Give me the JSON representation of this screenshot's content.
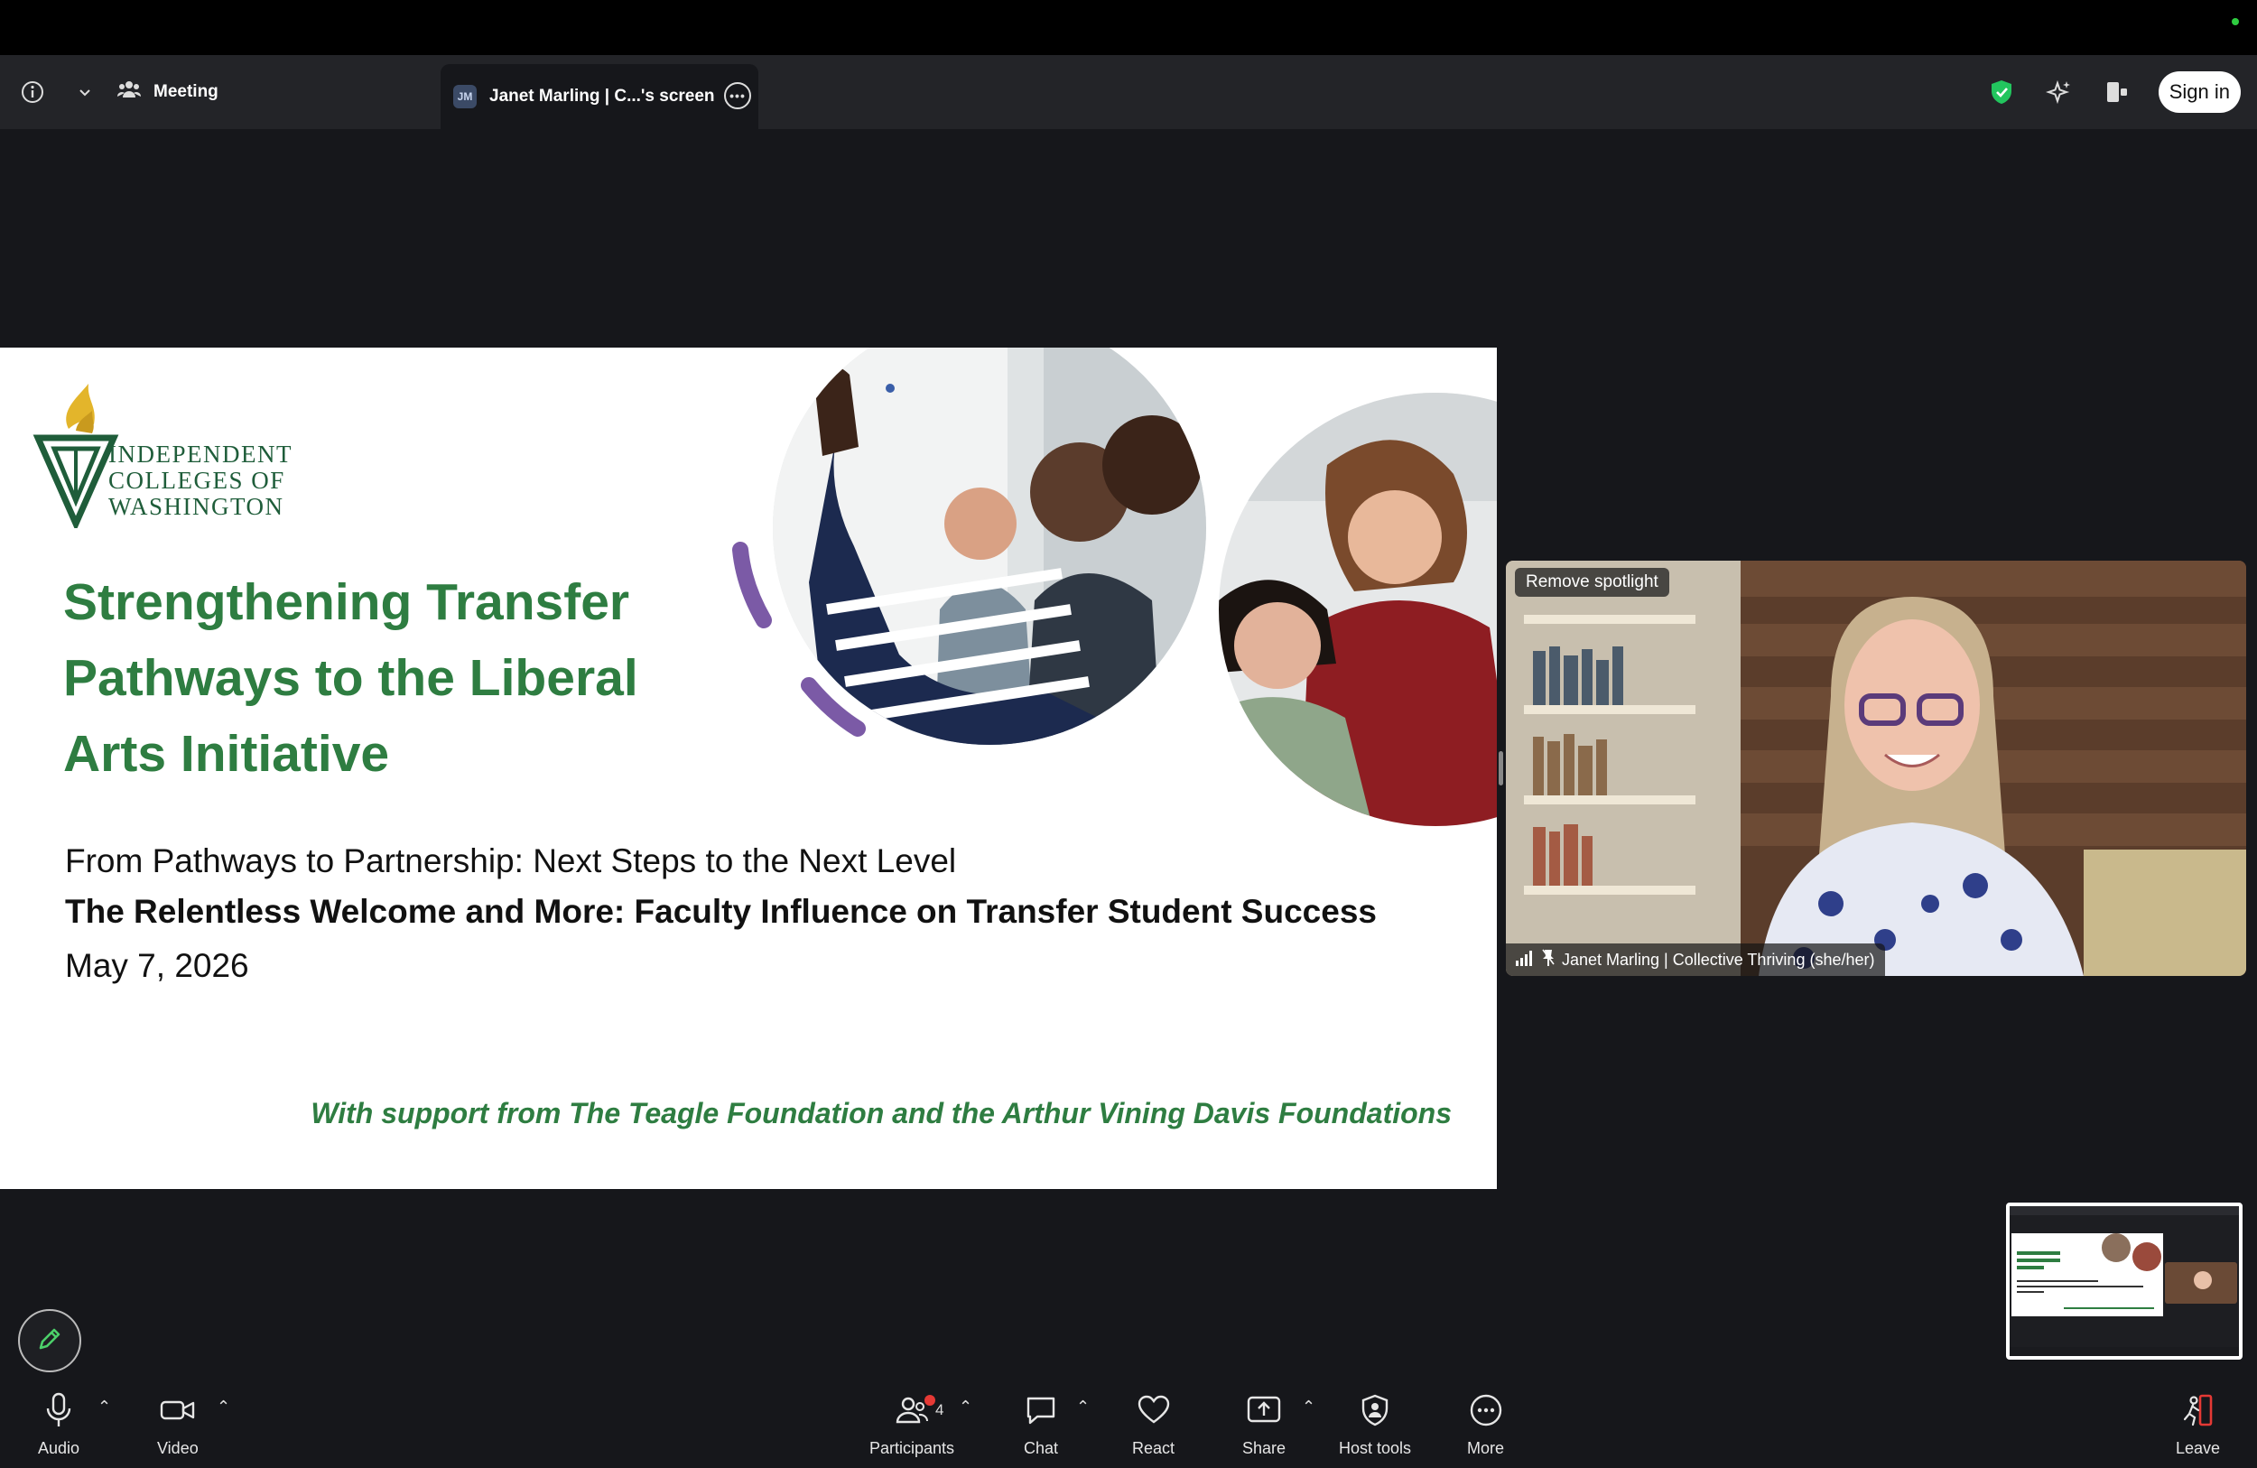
{
  "tabbar": {
    "meeting_label": "Meeting",
    "screen_badge": "JM",
    "screen_label": "Janet Marling | C...'s screen",
    "sign_in": "Sign in"
  },
  "slide": {
    "logo_lines": [
      "INDEPENDENT",
      "COLLEGES OF",
      "WASHINGTON"
    ],
    "title_lines": [
      "Strengthening Transfer",
      "Pathways to the Liberal",
      "Arts Initiative"
    ],
    "subtitle": "From Pathways to Partnership: Next Steps to the Next Level",
    "session_title": "The Relentless Welcome and More: Faculty Influence on Transfer Student Success",
    "date": "May 7, 2026",
    "support": "With support from The Teagle Foundation and the Arthur Vining Davis Foundations"
  },
  "video": {
    "remove_spotlight": "Remove spotlight",
    "participant_name": "Janet Marling | Collective Thriving (she/her)"
  },
  "toolbar": {
    "audio": "Audio",
    "video": "Video",
    "participants": "Participants",
    "participants_count": "4",
    "chat": "Chat",
    "react": "React",
    "share": "Share",
    "host_tools": "Host tools",
    "more": "More",
    "leave": "Leave"
  },
  "colors": {
    "slide_green": "#2e7d41",
    "accent_purple": "#7b5aa6",
    "toolbar_bg": "#16171b",
    "tabbar_bg": "#232428",
    "leave_red": "#e53935"
  },
  "icons": [
    "info-icon",
    "chevron-down-icon",
    "meeting-icon",
    "more-options-icon",
    "shield-check-icon",
    "ai-sparkle-icon",
    "layout-icon",
    "pencil-icon",
    "microphone-icon",
    "camera-icon",
    "participants-icon",
    "chat-icon",
    "heart-icon",
    "share-icon",
    "host-shield-icon",
    "more-icon",
    "leave-icon"
  ]
}
